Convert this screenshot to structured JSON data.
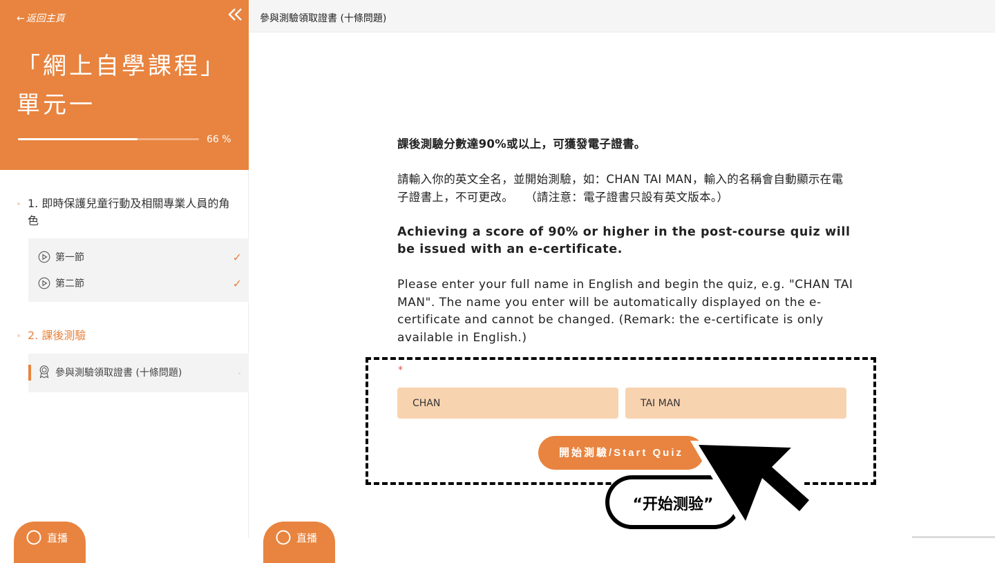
{
  "sidebar": {
    "back_label": "返回主頁",
    "collapse_icon": "double-chevron-left-icon",
    "course_title": "「網上自學課程」單元一",
    "progress": {
      "percent": 66,
      "label": "66 %"
    },
    "sections": [
      {
        "title": "1. 即時保護兒童行動及相關專業人員的角色",
        "lessons": [
          {
            "label": "第一節",
            "icon": "play-circle-icon",
            "completed": true,
            "status_glyph": "✓"
          },
          {
            "label": "第二節",
            "icon": "play-circle-icon",
            "completed": true,
            "status_glyph": "✓"
          }
        ]
      },
      {
        "title": "2. 課後測驗",
        "active": true,
        "items": [
          {
            "label": "參與測驗領取證書 (十條問題)",
            "icon": "award-icon",
            "active": true
          }
        ]
      }
    ],
    "live_button_label": "直播"
  },
  "topbar": {
    "title": "參與測驗領取證書 (十條問題)"
  },
  "main": {
    "intro_zh_bold": "課後測驗分數達90%或以上，可獲發電子證書。",
    "intro_zh": "請輸入你的英文全名，並開始測驗，如：CHAN TAI MAN，輸入的名稱會自動顯示在電子證書上，不可更改。　　（請注意：電子證書只設有英文版本。）",
    "intro_en_bold": "Achieving a score of 90% or higher in the post-course quiz will be issued with an e-certificate.",
    "intro_en": "Please enter your full name in English and begin the quiz, e.g. \"CHAN TAI MAN\". The name you enter will be automatically displayed on the e-certificate and cannot be changed. (Remark: the e-certificate is only available in English.)",
    "required_mark": "*",
    "surname_value": "CHAN",
    "given_name_value": "TAI MAN",
    "start_button_label": "開始測驗/Start Quiz",
    "live_button_label": "直播"
  },
  "annotation": {
    "callout_text": "“开始测验”"
  },
  "colors": {
    "accent": "#e8843f",
    "input_bg": "#f8d3b0",
    "sidebar_item_bg": "#f3f3f3"
  }
}
